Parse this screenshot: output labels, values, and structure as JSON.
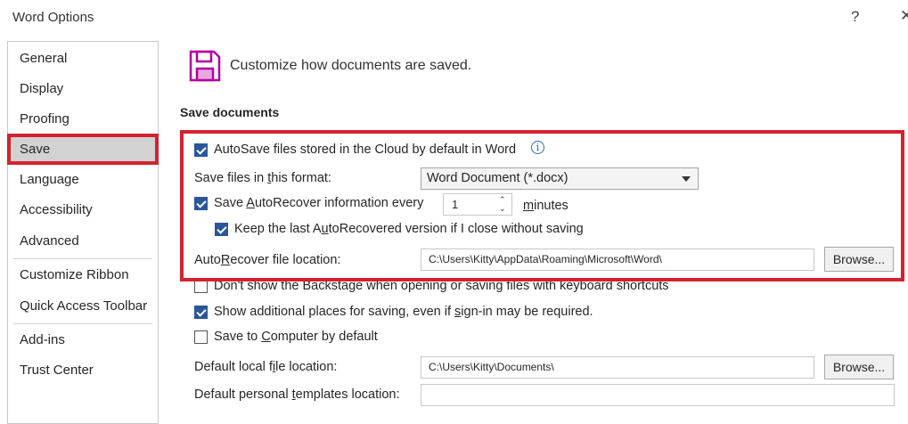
{
  "window": {
    "title": "Word Options",
    "help_label": "?",
    "close_label": "✕"
  },
  "sidebar": {
    "items": [
      {
        "label": "General"
      },
      {
        "label": "Display"
      },
      {
        "label": "Proofing"
      },
      {
        "label": "Save",
        "selected": true
      },
      {
        "label": "Language"
      },
      {
        "label": "Accessibility"
      },
      {
        "label": "Advanced"
      },
      {
        "label": "Customize Ribbon"
      },
      {
        "label": "Quick Access Toolbar"
      },
      {
        "label": "Add-ins"
      },
      {
        "label": "Trust Center"
      }
    ]
  },
  "header": {
    "icon": "save-floppy-icon",
    "text": "Customize how documents are saved."
  },
  "save_documents": {
    "title": "Save documents",
    "autosave": {
      "label": "AutoSave files stored in the Cloud by default in Word",
      "checked": true,
      "info_icon": "info-icon"
    },
    "format": {
      "label_pre": "Save files in ",
      "label_u": "t",
      "label_post": "his format:",
      "value": "Word Document (*.docx)"
    },
    "autorecover": {
      "label_pre": "Save ",
      "label_u": "A",
      "label_post": "utoRecover information every",
      "checked": true,
      "minutes_value": "1",
      "minutes_label_u": "m",
      "minutes_label_post": "inutes"
    },
    "keep_last": {
      "label_pre": "Keep the last A",
      "label_u": "u",
      "label_post": "toRecovered version if I close without saving",
      "checked": true
    },
    "autorecover_location": {
      "label_pre": "Auto",
      "label_u": "R",
      "label_post": "ecover file location:",
      "value": "C:\\Users\\Kitty\\AppData\\Roaming\\Microsoft\\Word\\",
      "button_label": "Browse..."
    },
    "dont_show_backstage": {
      "label": "Don't show the Backstage when opening or saving files with keyboard shortcuts",
      "checked": false
    },
    "show_additional": {
      "label_pre": "Show additional places for saving, even if ",
      "label_u": "s",
      "label_post": "ign-in may be required.",
      "checked": true
    },
    "save_to_computer": {
      "label_pre": "Save to ",
      "label_u": "C",
      "label_post": "omputer by default",
      "checked": false
    },
    "default_local": {
      "label_pre": "Default local f",
      "label_u": "i",
      "label_post": "le location:",
      "value": "C:\\Users\\Kitty\\Documents\\",
      "button_label": "Browse..."
    },
    "default_templates": {
      "label_pre": "Default personal ",
      "label_u": "t",
      "label_post": "emplates location:",
      "value": ""
    }
  },
  "colors": {
    "highlight": "#d3222f",
    "checkbox": "#2b579a",
    "selected_nav": "#d2d2d2",
    "save_icon": "#b4009e"
  }
}
